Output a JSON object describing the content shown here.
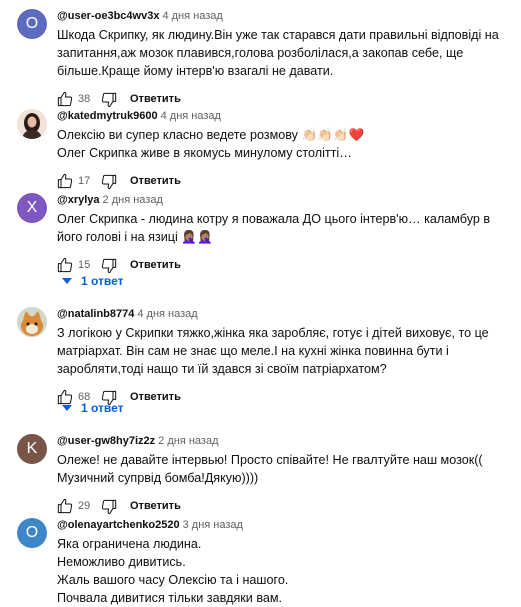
{
  "comments": [
    {
      "author": "@user-oe3bc4wv3x",
      "time": "4 дня назад",
      "avatar_letter": "О",
      "avatar_color": "#5c6bc0",
      "text": "Шкода Скрипку, як людину.Він уже так старався дати правильні відповіді на запитання,аж мозок плавився,голова розболілася,а закопав себе, ще більше.Краще йому інтерв'ю взагалі не давати.",
      "likes": "38",
      "reply_label": "Ответить"
    },
    {
      "author": "@katedmytruk9600",
      "time": "4 дня назад",
      "avatar_icon": "user-photo-icon",
      "text": "Олексію ви супер класно ведете розмову 👏🏻👏🏻👏🏻❤️\nОлег Скрипка живе в якомусь минулому столітті…",
      "likes": "17",
      "reply_label": "Ответить"
    },
    {
      "author": "@xrylya",
      "time": "2 дня назад",
      "avatar_letter": "X",
      "avatar_color": "#7e57c2",
      "text": "Олег Скрипка - людина котру я поважала ДО цього інтерв'ю… каламбур в його голові і на язиці 🤦🏽‍♀️🤦🏽‍♀️",
      "likes": "15",
      "reply_label": "Ответить",
      "replies_label": "1 ответ"
    },
    {
      "author": "@natalinb8774",
      "time": "4 дня назад",
      "avatar_icon": "cat-photo-icon",
      "text": "З логікою у Скрипки тяжко,жінка яка заробляє, готує і дітей виховує, то це матріархат. Він сам не знає що меле.І на кухні жінка повинна бути і заробляти,тоді нащо ти їй здався зі своїм патріархатом?",
      "likes": "68",
      "reply_label": "Ответить",
      "replies_label": "1 ответ"
    },
    {
      "author": "@user-gw8hy7iz2z",
      "time": "2 дня назад",
      "avatar_letter": "K",
      "avatar_color": "#795548",
      "text": "Олеже! не давайте інтервью! Просто співайте! Не гвалтуйте наш мозок(( Музичний супрвід бомба!Дякую))))",
      "likes": "29",
      "reply_label": "Ответить"
    },
    {
      "author": "@olenayartchenko2520",
      "time": "3 дня назад",
      "avatar_letter": "O",
      "avatar_color": "#3f86c8",
      "text": "Яка ограничена людина.\nНеможливо дивитись.\nЖаль вашого часу Олексію та і нашого.\nПочвала дивитися тільки завдяки вам."
    }
  ]
}
